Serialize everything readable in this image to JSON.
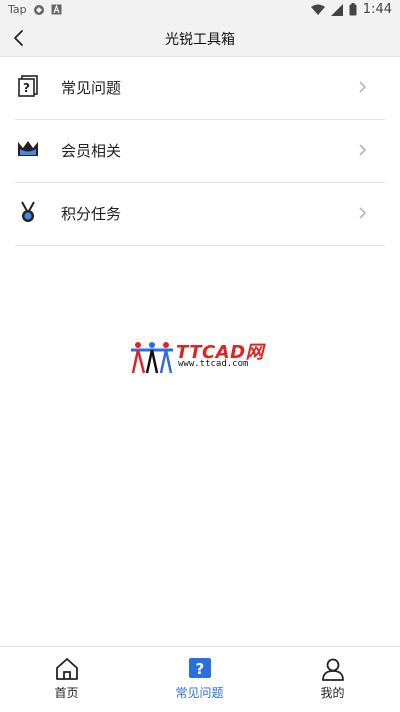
{
  "statusbar": {
    "left_text": "Tap",
    "time": "1:44"
  },
  "appbar": {
    "title": "光锐工具箱"
  },
  "menu": {
    "items": [
      {
        "label": "常见问题",
        "icon": "faq-icon"
      },
      {
        "label": "会员相关",
        "icon": "crown-icon"
      },
      {
        "label": "积分任务",
        "icon": "medal-icon"
      }
    ]
  },
  "logo": {
    "brand": "TTCAD网",
    "url": "www.ttcad.com"
  },
  "tabbar": {
    "tabs": [
      {
        "label": "首页",
        "icon": "home-icon",
        "active": false
      },
      {
        "label": "常见问题",
        "icon": "question-icon",
        "active": true
      },
      {
        "label": "我的",
        "icon": "user-icon",
        "active": false
      }
    ]
  },
  "colors": {
    "accent": "#2a6fe0",
    "background": "#ffffff",
    "bar": "#f2f2f2"
  }
}
